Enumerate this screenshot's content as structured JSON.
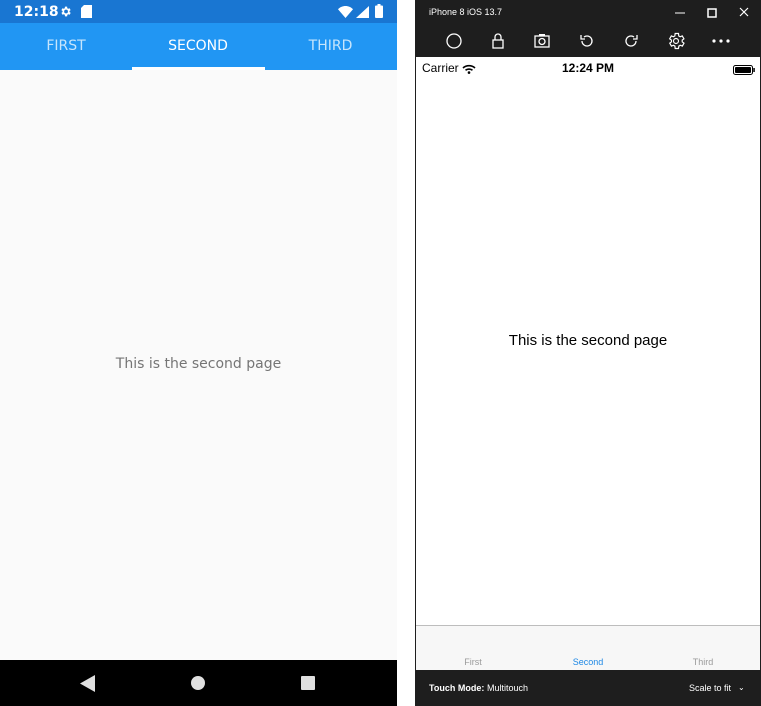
{
  "android": {
    "status_bar": {
      "time": "12:18"
    },
    "tabs": [
      {
        "label": "FIRST"
      },
      {
        "label": "SECOND"
      },
      {
        "label": "THIRD"
      }
    ],
    "selected_tab": 1,
    "content_text": "This is the second page",
    "colors": {
      "status_bar": "#1976d2",
      "tab_bar": "#2196f3",
      "background": "#fafafa",
      "nav_bar": "#000000"
    }
  },
  "ios_simulator": {
    "window_title": "iPhone 8 iOS 13.7",
    "toolbar_icons": [
      "home-icon",
      "lock-icon",
      "screenshot-icon",
      "rotate-left-icon",
      "rotate-right-icon",
      "settings-icon",
      "more-icon"
    ],
    "status_bar": {
      "carrier": "Carrier",
      "time": "12:24 PM"
    },
    "content_text": "This is the second page",
    "tabs": [
      {
        "label": "First"
      },
      {
        "label": "Second"
      },
      {
        "label": "Third"
      }
    ],
    "selected_tab": 1,
    "footer": {
      "touch_mode_label": "Touch Mode:",
      "touch_mode_value": "Multitouch",
      "scale_label": "Scale to fit"
    },
    "colors": {
      "window": "#1e1e1e",
      "accent": "#1e88e5",
      "inactive_tab": "#9a9a9a"
    }
  }
}
